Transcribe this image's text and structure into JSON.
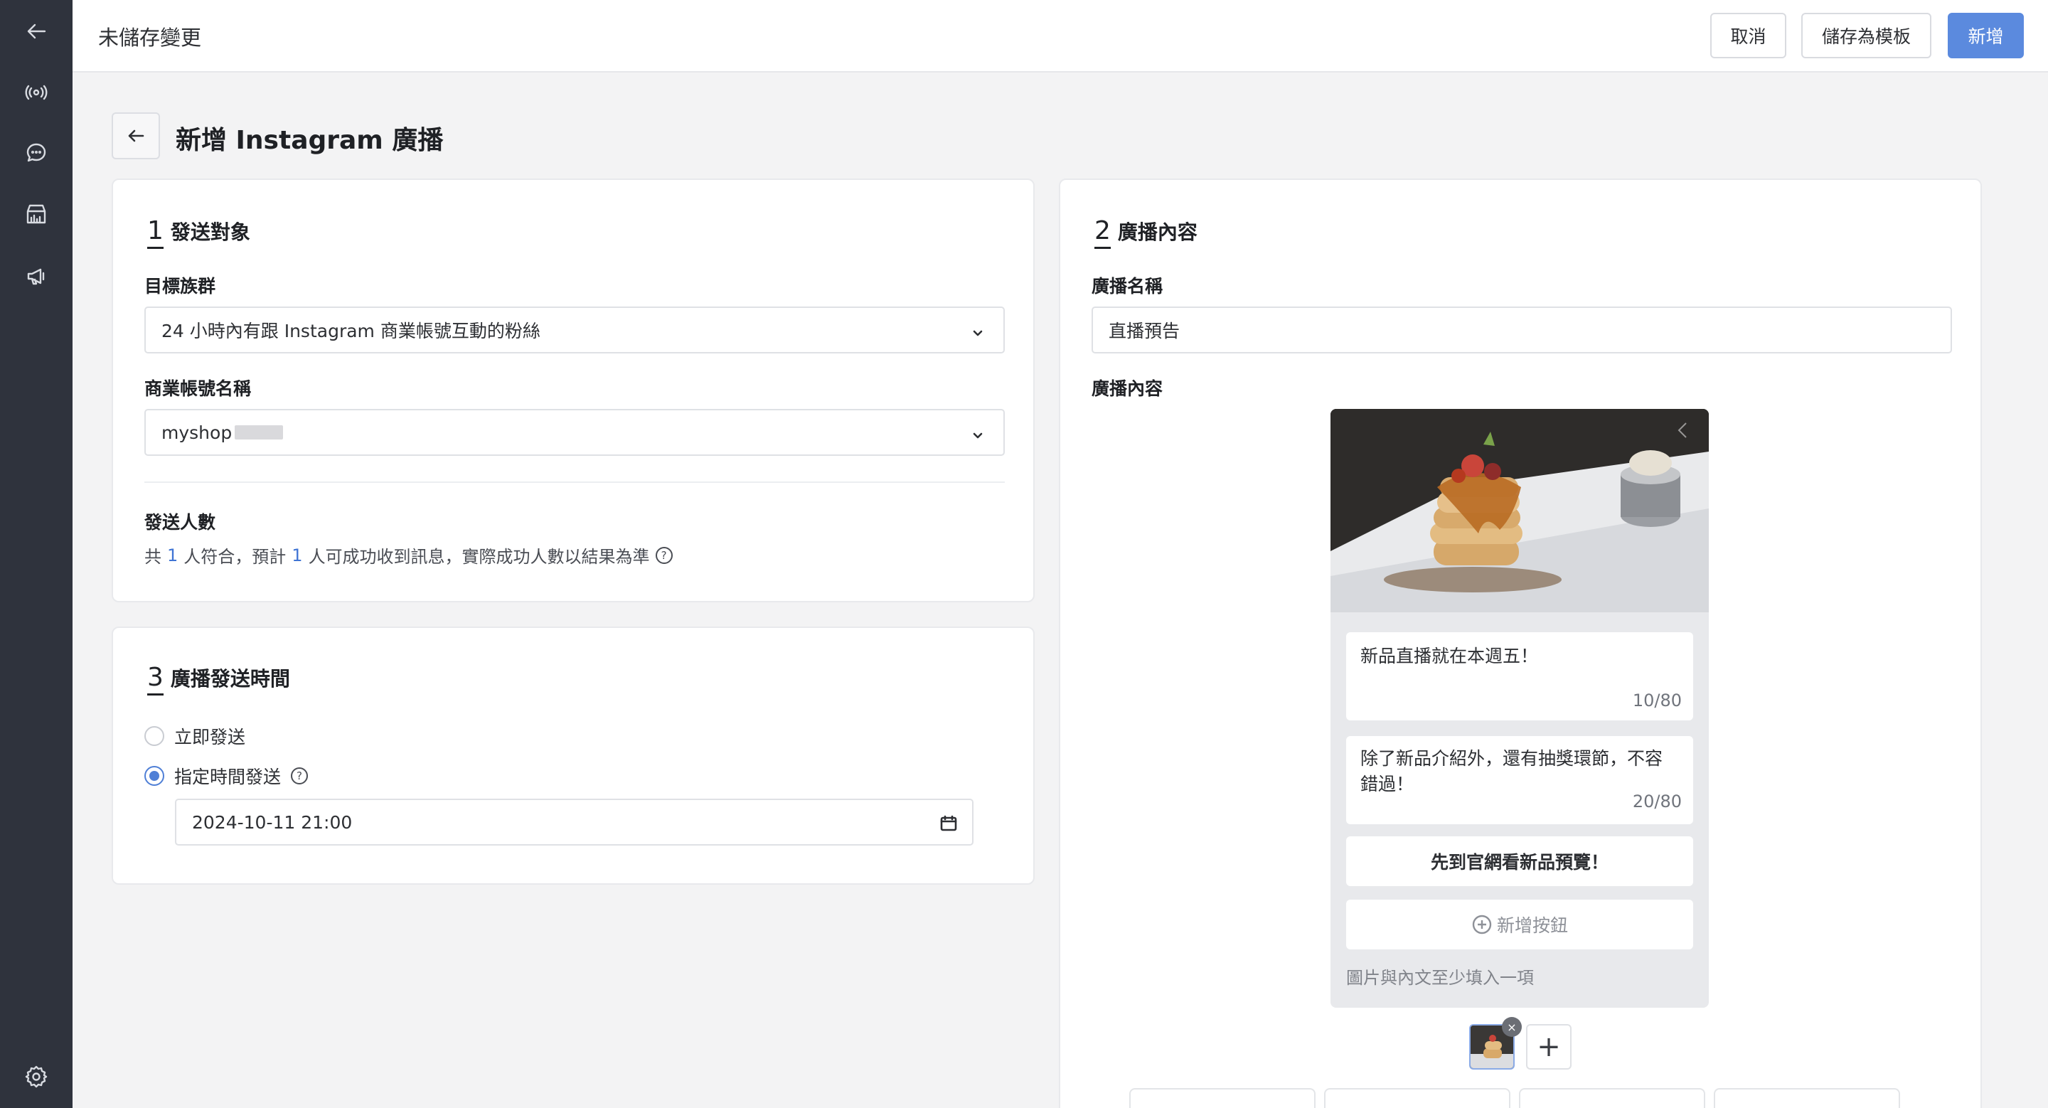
{
  "topbar": {
    "title": "未儲存變更",
    "cancel_label": "取消",
    "save_template_label": "儲存為模板",
    "create_label": "新增"
  },
  "sidebar": {
    "icons": [
      "back-arrow-icon",
      "broadcast-icon",
      "chat-icon",
      "store-icon",
      "megaphone-icon",
      "gear-icon"
    ]
  },
  "page": {
    "title": "新增 Instagram 廣播"
  },
  "audience": {
    "number": "1",
    "title": "發送對象",
    "target_label": "目標族群",
    "target_value": "24 小時內有跟 Instagram 商業帳號互動的粉絲",
    "account_label": "商業帳號名稱",
    "account_value": "myshop",
    "count_label": "發送人數",
    "count_prefix": "共",
    "count_total": "1",
    "count_mid": "人符合，預計",
    "count_success": "1",
    "count_suffix": "人可成功收到訊息，實際成功人數以結果為準",
    "help_glyph": "?"
  },
  "schedule": {
    "number": "3",
    "title": "廣播發送時間",
    "option_now": "立即發送",
    "option_scheduled": "指定時間發送",
    "selected": "scheduled",
    "datetime_value": "2024-10-11 21:00",
    "help_glyph": "?"
  },
  "content": {
    "number": "2",
    "title": "廣播內容",
    "name_label": "廣播名稱",
    "name_value": "直播預告",
    "content_label": "廣播內容",
    "bubble1_text": "新品直播就在本週五！",
    "bubble1_counter": "10/80",
    "bubble2_text": "除了新品介紹外，還有抽獎環節，不容錯過！",
    "bubble2_counter": "20/80",
    "cta_label": "先到官網看新品預覽！",
    "add_button_label": "新增按鈕",
    "hint": "圖片與內文至少填入一項",
    "thumb_close_glyph": "×",
    "add_media_glyph": "+"
  },
  "colors": {
    "sidebar_bg": "#2f333d",
    "primary": "#5b8ade",
    "accent_number": "#3f74d4"
  }
}
